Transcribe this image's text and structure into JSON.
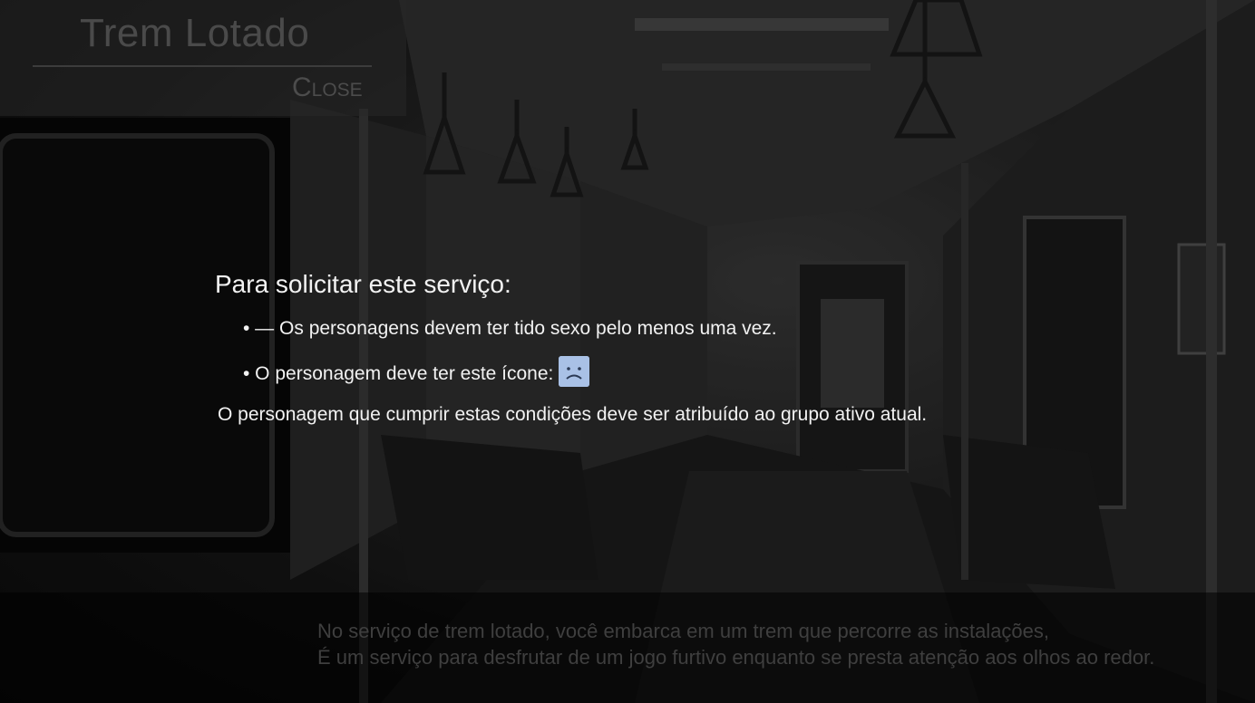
{
  "header": {
    "title": "Trem Lotado",
    "close_label": "Close"
  },
  "requirements": {
    "heading": "Para solicitar este serviço:",
    "items": [
      "• — Os personagens devem ter tido sexo pelo menos uma vez.",
      "• O personagem deve ter este ícone:"
    ],
    "required_icon": "sad-face-icon",
    "note": "O personagem que cumprir estas condições deve ser atribuído ao grupo ativo atual."
  },
  "description": {
    "line1": "No serviço de trem lotado, você embarca em um trem que percorre as instalações,",
    "line2": "É um serviço para desfrutar de um jogo furtivo enquanto se presta atenção aos olhos ao redor."
  },
  "colors": {
    "icon_bg": "#a9c1e6",
    "text": "#f2f2f2",
    "dim_text": "#3f3f3f"
  }
}
